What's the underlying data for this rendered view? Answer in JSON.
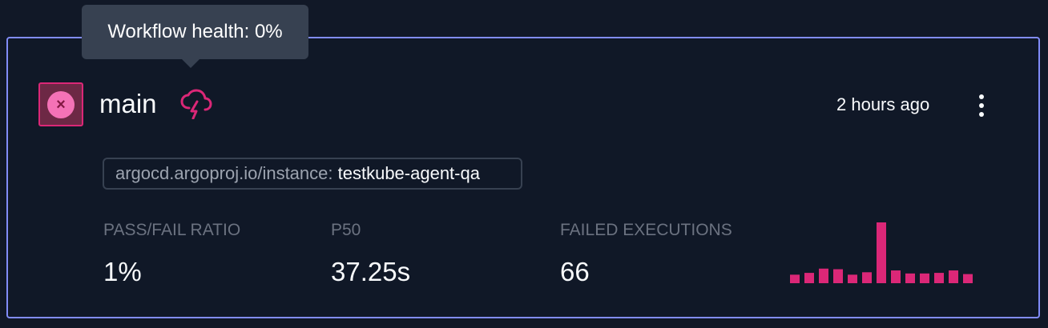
{
  "tooltip": {
    "text": "Workflow health: 0%"
  },
  "workflow": {
    "name": "main",
    "status_icon": "x-icon",
    "health_icon": "cloud-lightning-icon",
    "timestamp": "2 hours ago",
    "menu_icon": "more-vertical-icon",
    "label": {
      "key": "argocd.argoproj.io/instance:",
      "value": "testkube-agent-qa"
    }
  },
  "metrics": {
    "pass_fail_ratio": {
      "label": "PASS/FAIL RATIO",
      "value": "1%"
    },
    "p50": {
      "label": "P50",
      "value": "37.25s"
    },
    "failed_executions": {
      "label": "FAILED EXECUTIONS",
      "value": "66"
    }
  },
  "chart_data": {
    "type": "bar",
    "categories": [],
    "values": [
      0.14,
      0.17,
      0.24,
      0.23,
      0.14,
      0.18,
      1.0,
      0.21,
      0.16,
      0.16,
      0.17,
      0.21,
      0.15
    ],
    "title": "",
    "xlabel": "",
    "ylabel": "",
    "ylim": [
      0,
      1
    ]
  },
  "colors": {
    "accent": "#818cf8",
    "failure": "#db2777",
    "failure_light": "#f472b6",
    "background": "#111827",
    "muted_text": "#6b7280"
  }
}
